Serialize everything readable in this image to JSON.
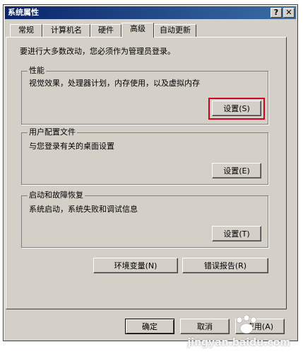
{
  "window": {
    "title": "系统属性",
    "help_label": "?",
    "close_label": "✕"
  },
  "tabs": [
    {
      "label": "常规"
    },
    {
      "label": "计算机名"
    },
    {
      "label": "硬件"
    },
    {
      "label": "高级",
      "active": true
    },
    {
      "label": "自动更新"
    }
  ],
  "advanced": {
    "intro": "要进行大多数改动，您必须作为管理员登录。",
    "performance": {
      "title": "性能",
      "description": "视觉效果，处理器计划，内存使用，以及虚拟内存",
      "settings_label": "设置(S)"
    },
    "user_profiles": {
      "title": "用户配置文件",
      "description": "与您登录有关的桌面设置",
      "settings_label": "设置(E)"
    },
    "startup_recovery": {
      "title": "启动和故障恢复",
      "description": "系统启动，系统失败和调试信息",
      "settings_label": "设置(T)"
    },
    "env_vars_label": "环境变量(N)",
    "error_report_label": "错误报告(R)"
  },
  "footer": {
    "ok_label": "确定",
    "cancel_label": "取消",
    "apply_label": "应用(A)"
  },
  "watermark": {
    "text": "jingyan.baidu.com"
  },
  "colors": {
    "face": "#d4d0c8",
    "title_start": "#0a246a",
    "title_end": "#3a6ea5",
    "highlight": "#d0021b"
  }
}
